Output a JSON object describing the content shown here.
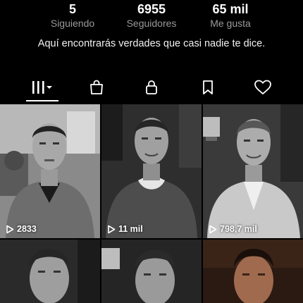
{
  "stats": [
    {
      "value": "5",
      "label": "Siguiendo"
    },
    {
      "value": "6955",
      "label": "Seguidores"
    },
    {
      "value": "65 mil",
      "label": "Me gusta"
    }
  ],
  "bio": "Aquí encontrarás verdades que casi nadie te dice.",
  "tabs": [
    {
      "icon": "grid-videos-icon",
      "active": true
    },
    {
      "icon": "shopping-bag-icon",
      "active": false
    },
    {
      "icon": "lock-icon",
      "active": false
    },
    {
      "icon": "bookmark-icon",
      "active": false
    },
    {
      "icon": "heart-icon",
      "active": false
    }
  ],
  "videos": [
    {
      "views": "2833"
    },
    {
      "views": "11 mil"
    },
    {
      "views": "798,7 mil"
    },
    {
      "views": ""
    },
    {
      "views": ""
    },
    {
      "views": ""
    }
  ],
  "colors": {
    "background": "#000000",
    "text": "#ffffff",
    "muted": "#9a9a9a"
  }
}
